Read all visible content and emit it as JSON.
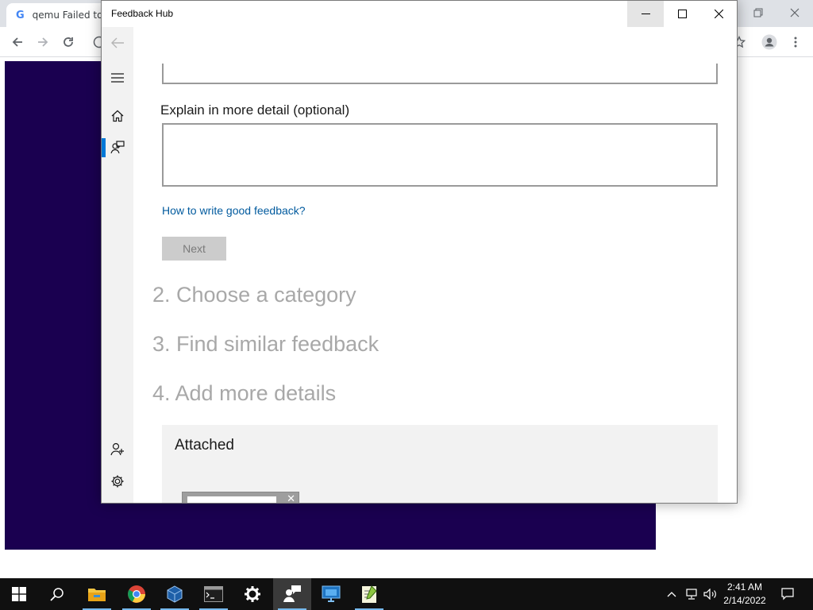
{
  "browser": {
    "tab_title": "qemu Failed to",
    "tab_favicon_letter": "G",
    "toolbar_icons": [
      "back-icon",
      "forward-icon",
      "reload-icon",
      "info-icon",
      "star-icon",
      "profile-icon",
      "menu-dots-icon"
    ],
    "page_bg": "#1a0050"
  },
  "feedback_hub": {
    "title": "Feedback Hub",
    "nav": {
      "items": [
        "back-arrow-icon",
        "hamburger-icon",
        "home-icon",
        "feedback-icon",
        "add-user-icon",
        "settings-icon"
      ],
      "active": "feedback-icon",
      "accent": "#0078d7"
    },
    "form": {
      "detail_label": "Explain in more detail (optional)",
      "detail_value": "",
      "help_link": "How to write good feedback?",
      "next_label": "Next",
      "next_enabled": false
    },
    "steps": [
      "2. Choose a category",
      "3. Find similar feedback",
      "4. Add more details"
    ],
    "attached": {
      "title": "Attached"
    }
  },
  "taskbar": {
    "pinned": [
      "start-icon",
      "search-icon",
      "file-explorer-icon",
      "chrome-icon",
      "virtualbox-icon",
      "terminal-icon",
      "settings-icon",
      "feedback-hub-icon",
      "remote-desktop-icon",
      "notepad-plus-icon"
    ],
    "active": "feedback-hub-icon",
    "clock_time": "2:41 AM",
    "clock_date": "2/14/2022",
    "tray": [
      "chevron-up-icon",
      "network-icon",
      "volume-icon",
      "notifications-icon"
    ]
  }
}
